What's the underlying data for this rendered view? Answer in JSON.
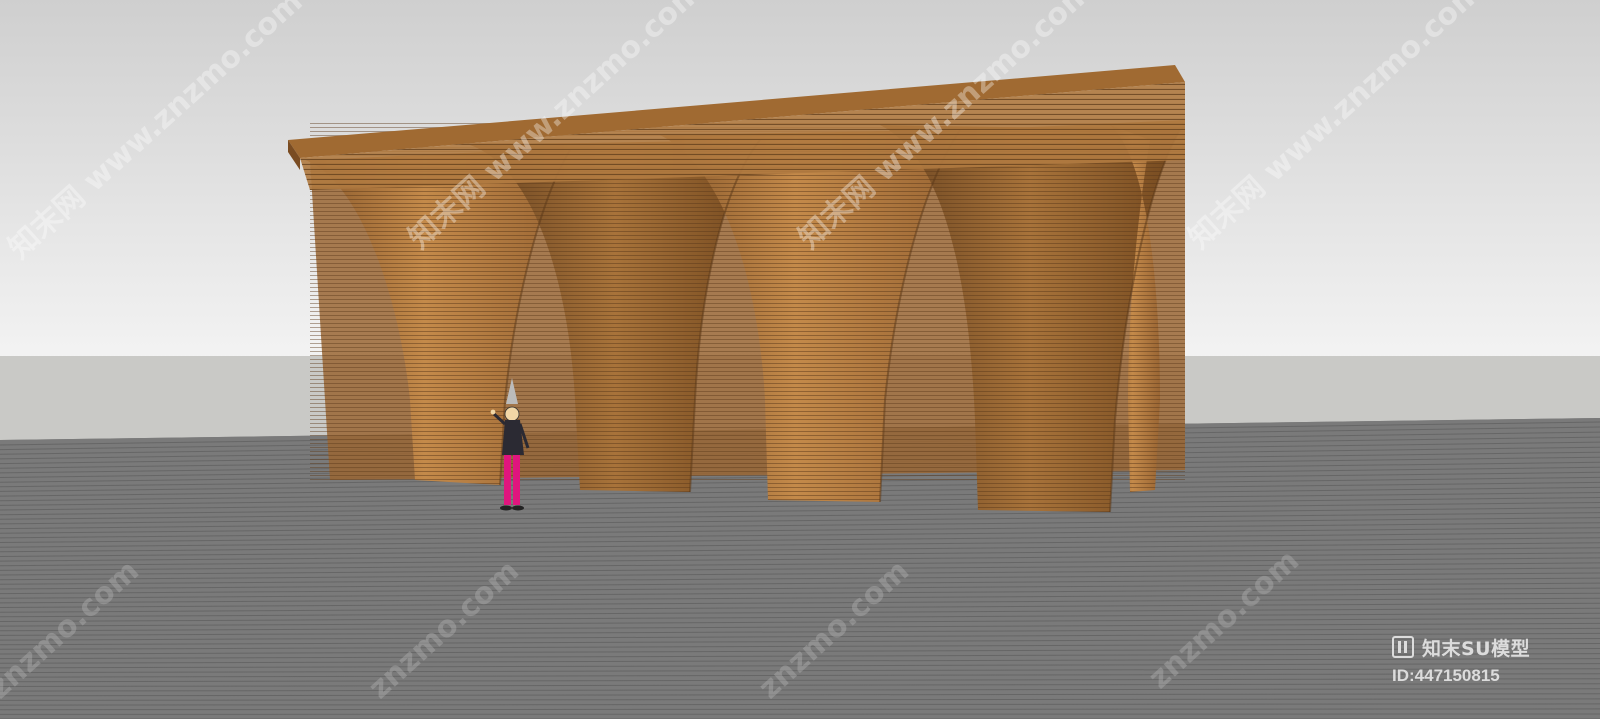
{
  "watermark": {
    "site": "www.znzmo.com",
    "brand_cjk": "知末网",
    "domain": "znzmo.com",
    "brand_name": "知末SU模型",
    "model_id": "ID:447150815",
    "logo_icon": "znzmo-logo-icon"
  },
  "colors": {
    "sky_top": "#cfcfcf",
    "sky_bottom": "#f3f3f3",
    "horizon": "#c9c9c6",
    "ground": "#7a7a7a",
    "ground_lines": "#666666",
    "wood_light": "#c48a4a",
    "wood_mid": "#a8733a",
    "wood_dark": "#6a4420",
    "roof_top": "#a06a32"
  }
}
